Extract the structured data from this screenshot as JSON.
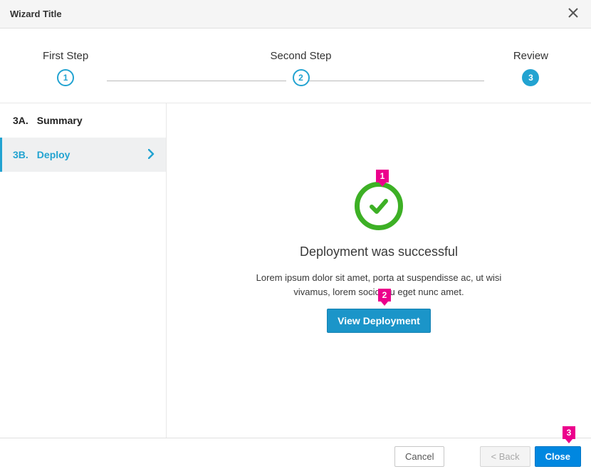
{
  "header": {
    "title": "Wizard Title"
  },
  "steps": [
    {
      "label": "First Step",
      "num": "1",
      "state": "done"
    },
    {
      "label": "Second Step",
      "num": "2",
      "state": "done"
    },
    {
      "label": "Review",
      "num": "3",
      "state": "active"
    }
  ],
  "sidebar": {
    "items": [
      {
        "index": "3A.",
        "label": "Summary",
        "active": false
      },
      {
        "index": "3B.",
        "label": "Deploy",
        "active": true
      }
    ]
  },
  "content": {
    "title": "Deployment was successful",
    "description": "Lorem ipsum dolor sit amet, porta at suspendisse ac, ut wisi vivamus, lorem sociosqu eget nunc amet.",
    "primary_button": "View Deployment"
  },
  "footer": {
    "cancel": "Cancel",
    "back": "< Back",
    "close": "Close"
  },
  "annotations": {
    "a1": "1",
    "a2": "2",
    "a3": "3"
  }
}
